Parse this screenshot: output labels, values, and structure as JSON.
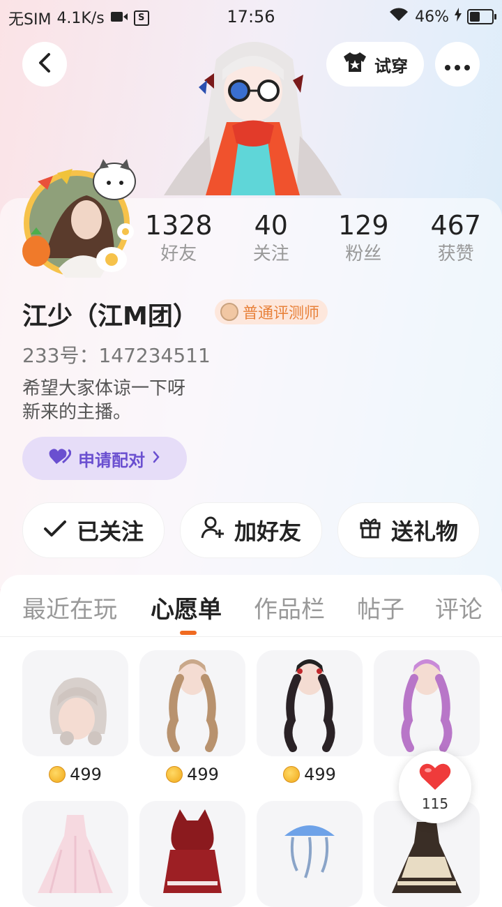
{
  "status_bar": {
    "carrier": "无SIM",
    "speed": "4.1K/s",
    "time": "17:56",
    "battery": "46%"
  },
  "top": {
    "tryon_label": "试穿"
  },
  "stats": [
    {
      "num": "1328",
      "label": "好友"
    },
    {
      "num": "40",
      "label": "关注"
    },
    {
      "num": "129",
      "label": "粉丝"
    },
    {
      "num": "467",
      "label": "获赞"
    }
  ],
  "profile": {
    "name": "江少（江M团）",
    "badge": "普通评测师",
    "uid": "233号：147234511",
    "bio": "希望大家体谅一下呀\n新来的主播。",
    "pair_label": "申请配对"
  },
  "actions": {
    "following": "已关注",
    "add_friend": "加好友",
    "gift": "送礼物"
  },
  "tabs": [
    "最近在玩",
    "心愿单",
    "作品栏",
    "帖子",
    "评论"
  ],
  "active_tab": "心愿单",
  "wishlist": [
    {
      "price": "499",
      "icon": "short-bob-hair"
    },
    {
      "price": "499",
      "icon": "blonde-curly-twintails"
    },
    {
      "price": "499",
      "icon": "black-curly-twintails"
    },
    {
      "price": "",
      "icon": "purple-curly-twintails"
    },
    {
      "price": "",
      "icon": "pink-ball-gown"
    },
    {
      "price": "",
      "icon": "red-riding-hood-outfit"
    },
    {
      "price": "",
      "icon": "jellyfish-accessory"
    },
    {
      "price": "",
      "icon": "gothic-lolita-dress"
    }
  ],
  "likes": "115",
  "colors": {
    "accent": "#f06a21",
    "pair_purple": "#6a4fd0",
    "heart_red": "#ef3b3b"
  }
}
